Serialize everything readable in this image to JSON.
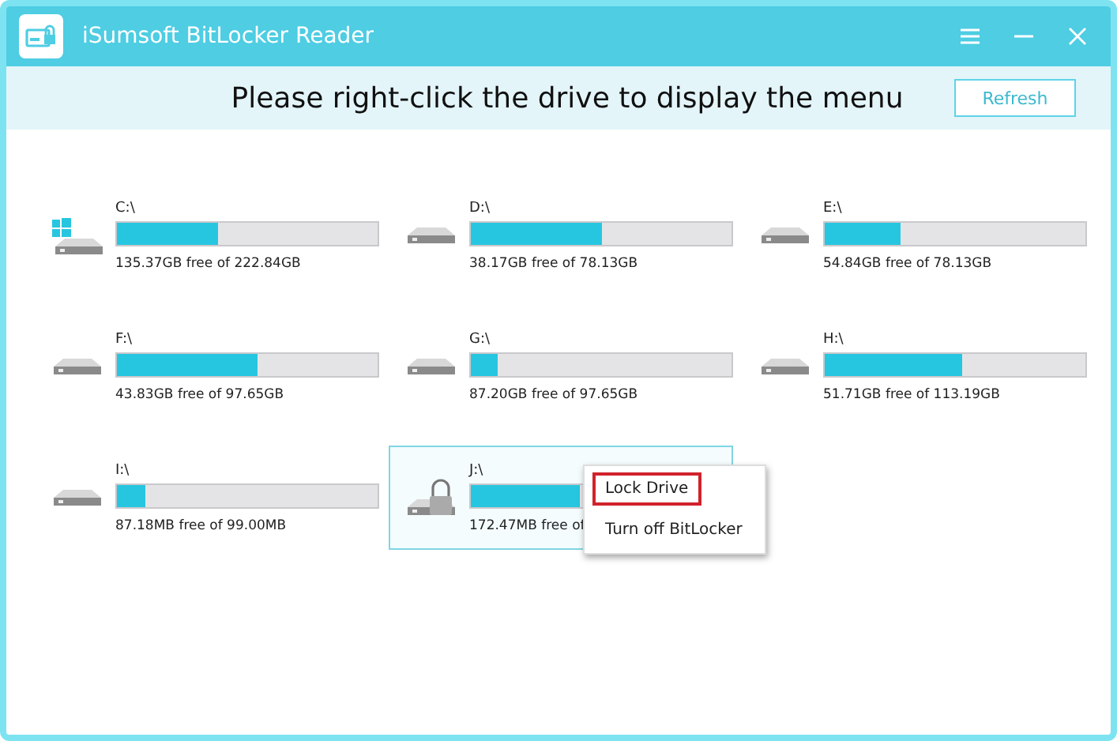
{
  "window": {
    "title": "iSumsoft BitLocker Reader"
  },
  "header": {
    "instruction": "Please right-click the drive to display the menu",
    "refresh_button": "Refresh"
  },
  "drives": [
    {
      "kind": "system",
      "label": "C:\\",
      "level": 0.39,
      "info": "135.37GB free of 222.84GB",
      "selected": false
    },
    {
      "kind": "normal",
      "label": "D:\\",
      "level": 0.5,
      "info": "38.17GB free of 78.13GB",
      "selected": false
    },
    {
      "kind": "normal",
      "label": "E:\\",
      "level": 0.29,
      "info": "54.84GB free of 78.13GB",
      "selected": false
    },
    {
      "kind": "normal",
      "label": "F:\\",
      "level": 0.54,
      "info": "43.83GB free of 97.65GB",
      "selected": false
    },
    {
      "kind": "normal",
      "label": "G:\\",
      "level": 0.1,
      "info": "87.20GB free of 97.65GB",
      "selected": false
    },
    {
      "kind": "normal",
      "label": "H:\\",
      "level": 0.53,
      "info": "51.71GB free of 113.19GB",
      "selected": false
    },
    {
      "kind": "normal",
      "label": "I:\\",
      "level": 0.11,
      "info": "87.18MB free of 99.00MB",
      "selected": false
    },
    {
      "kind": "locked",
      "label": "J:\\",
      "level": 0.42,
      "info": "172.47MB free of",
      "selected": true
    }
  ],
  "context_menu": {
    "items": [
      {
        "label": "Lock Drive",
        "selected": true
      },
      {
        "label": "Turn off BitLocker",
        "selected": false
      }
    ]
  }
}
